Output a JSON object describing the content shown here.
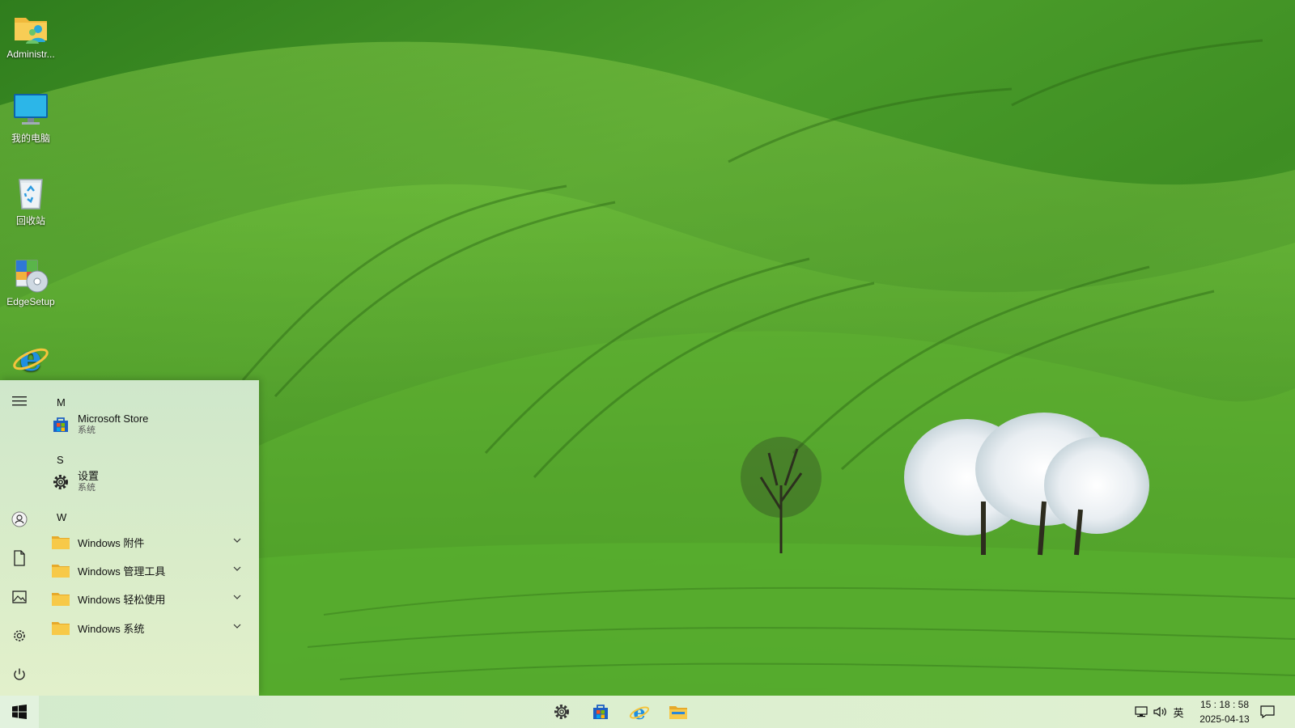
{
  "desktop": {
    "icons": [
      {
        "label": "Administr...",
        "icon": "user-folder-icon"
      },
      {
        "label": "我的电脑",
        "icon": "computer-icon"
      },
      {
        "label": "回收站",
        "icon": "recycle-bin-icon"
      },
      {
        "label": "EdgeSetup",
        "icon": "setup-installer-icon"
      },
      {
        "label": "",
        "icon": "internet-explorer-icon"
      }
    ]
  },
  "start_menu": {
    "rail": [
      "hamburger-menu-icon",
      "user-icon",
      "documents-icon",
      "pictures-icon",
      "settings-icon",
      "power-icon"
    ],
    "groups": [
      {
        "letter": "M"
      },
      {
        "letter": "S"
      },
      {
        "letter": "W"
      }
    ],
    "apps": [
      {
        "name": "Microsoft Store",
        "sub": "系统",
        "icon": "store-icon"
      },
      {
        "name": "设置",
        "sub": "系统",
        "icon": "gear-icon"
      }
    ],
    "folders": [
      {
        "name": "Windows 附件",
        "icon": "folder-icon"
      },
      {
        "name": "Windows 管理工具",
        "icon": "folder-icon"
      },
      {
        "name": "Windows 轻松使用",
        "icon": "folder-icon"
      },
      {
        "name": "Windows 系统",
        "icon": "folder-icon"
      }
    ]
  },
  "taskbar": {
    "pinned": [
      "settings-icon",
      "store-icon",
      "internet-explorer-icon",
      "file-explorer-icon"
    ],
    "tray": {
      "ime": "英",
      "time": "15 : 18 : 58",
      "date": "2025-04-13"
    }
  },
  "colors": {
    "taskbar_bg": "#dcefcf",
    "start_bg": "#d9ecc9",
    "store_blue": "#1d5fc4",
    "folder_yellow": "#f7c948"
  }
}
